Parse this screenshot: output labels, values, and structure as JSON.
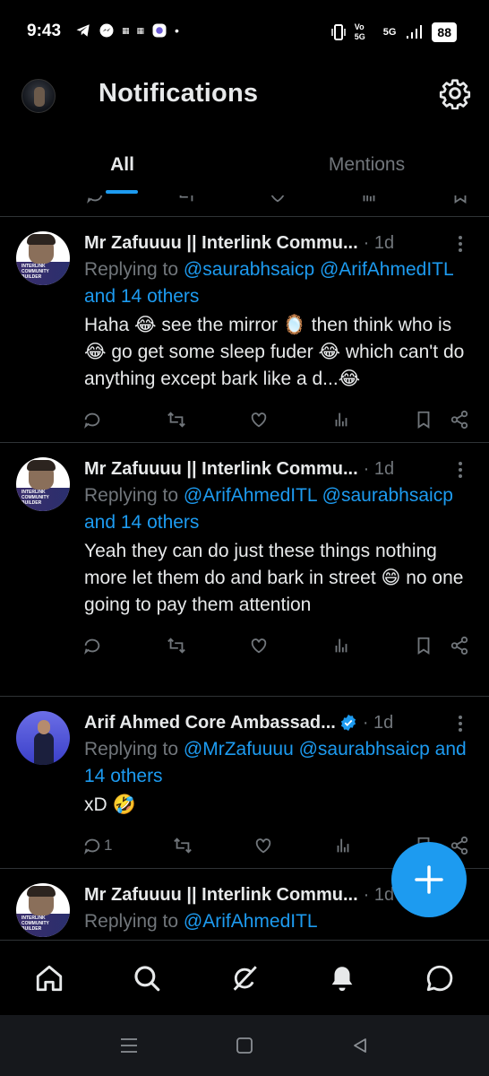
{
  "status_bar": {
    "time": "9:43",
    "network": "5G",
    "volte": "Vo 5G",
    "battery": "88"
  },
  "header": {
    "title": "Notifications"
  },
  "tabs": [
    {
      "label": "All",
      "active": true
    },
    {
      "label": "Mentions",
      "active": false
    }
  ],
  "posts": [
    {
      "author": "Mr Zafuuuu || Interlink Commu...",
      "time": "· 1d",
      "reply_prefix": "Replying to ",
      "reply_mentions": "@saurabhsaicp @ArifAhmedITL",
      "reply_suffix": " and 14 others",
      "text": "Haha 😂 see the mirror 🪞 then think who is 😂 go get some sleep fuder 😂 which can't do anything except bark like a d...😂",
      "reply_count": "",
      "verified": false
    },
    {
      "author": "Mr Zafuuuu || Interlink Commu...",
      "time": "· 1d",
      "reply_prefix": "Replying to ",
      "reply_mentions": "@ArifAhmedITL @saurabhsaicp",
      "reply_suffix": " and 14 others",
      "text": "Yeah  they can do just these things nothing more let them do and bark in street 😄 no one going to pay them attention",
      "reply_count": "",
      "verified": false
    },
    {
      "author": "Arif Ahmed Core Ambassad...",
      "time": "· 1d",
      "reply_prefix": "Replying to ",
      "reply_mentions": "@MrZafuuuu @saurabhsaicp",
      "reply_suffix": " and 14 others",
      "text": "xD 🤣",
      "reply_count": "1",
      "verified": true
    },
    {
      "author": "Mr Zafuuuu || Interlink Commu...",
      "time": "· 1d",
      "reply_prefix": "Replying to ",
      "reply_mentions": "@ArifAhmedITL",
      "reply_suffix": "",
      "text": "",
      "reply_count": "",
      "verified": false
    }
  ],
  "avatar_badge_text": "INTERLINK COMMUNITY BUILDER",
  "colors": {
    "accent": "#1d9bf0",
    "muted": "#71767b",
    "divider": "#2f3336",
    "background": "#000000"
  },
  "icons": {
    "settings": "gear-icon",
    "home": "home-icon",
    "search": "search-icon",
    "grok": "grok-icon",
    "notifications": "bell-icon",
    "messages": "chat-icon",
    "compose": "plus-icon"
  }
}
